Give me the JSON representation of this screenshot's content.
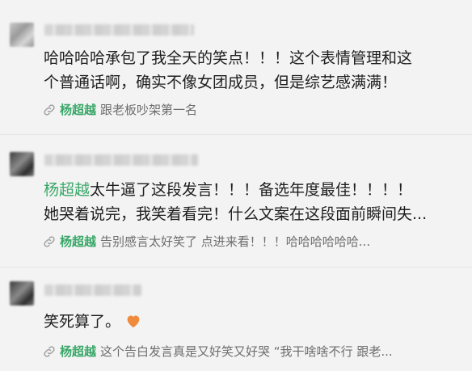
{
  "comments": [
    {
      "user_blurred": true,
      "text_line1": "哈哈哈哈承包了我全天的笑点！！！这个表情管理和这",
      "text_line2": "个普通话啊，确实不像女团成员，但是综艺感满满！",
      "link_name": "杨超越",
      "link_text": "跟老板吵架第一名"
    },
    {
      "user_blurred": true,
      "text_highlight": "杨超越",
      "text_line1": "太牛逼了这段发言！！！备选年度最佳！！！！",
      "text_line2": "她哭着说完，我笑着看完！什么文案在这段面前瞬间失...",
      "link_name": "杨超越",
      "link_text": "告别感言太好笑了 点进来看！！！哈哈哈哈哈哈..."
    },
    {
      "user_blurred": true,
      "text_line1": "笑死算了。",
      "emoji": "orange-heart",
      "link_name": "杨超越",
      "link_text": "这个告白发言真是又好笑又好哭 “我干啥啥不行 跟老..."
    }
  ],
  "colors": {
    "background": "#f3f3f3",
    "accent_green": "#3aa869",
    "secondary_text": "#6d6d6d",
    "heart": "#f08a3c"
  }
}
